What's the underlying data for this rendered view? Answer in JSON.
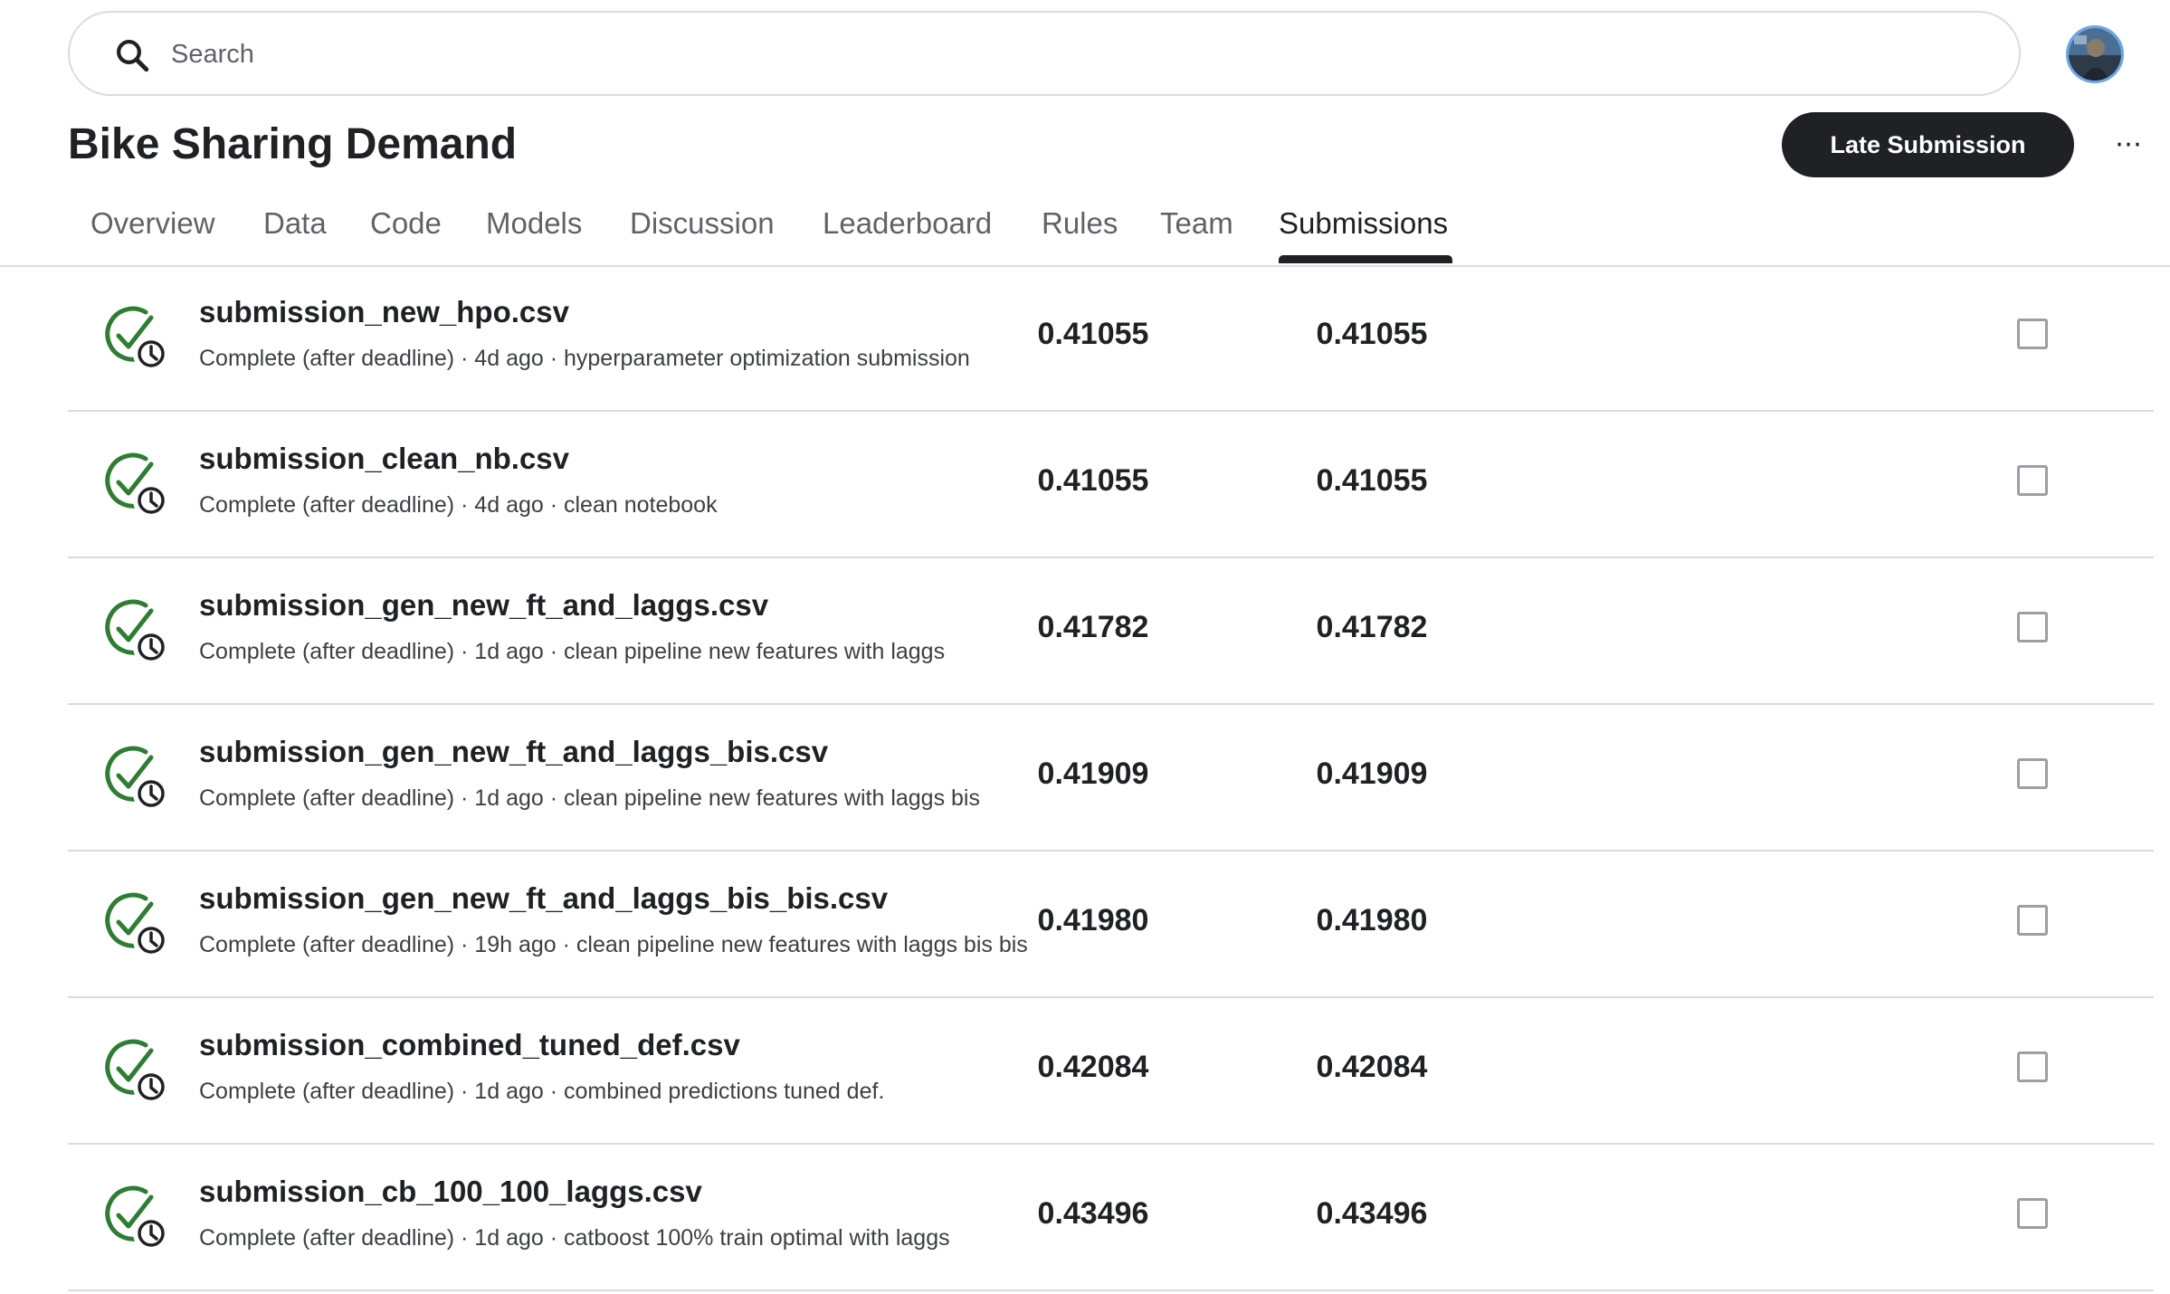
{
  "search": {
    "placeholder": "Search"
  },
  "header": {
    "title": "Bike Sharing Demand",
    "late_submission_label": "Late Submission",
    "more_label": "⋯"
  },
  "tabs": [
    {
      "label": "Overview"
    },
    {
      "label": "Data"
    },
    {
      "label": "Code"
    },
    {
      "label": "Models"
    },
    {
      "label": "Discussion"
    },
    {
      "label": "Leaderboard"
    },
    {
      "label": "Rules"
    },
    {
      "label": "Team"
    },
    {
      "label": "Submissions",
      "active": true
    }
  ],
  "colors": {
    "accent_dark": "#202124",
    "success_green": "#2e7d32",
    "divider": "#dadce0"
  },
  "submissions": [
    {
      "name": "submission_new_hpo.csv",
      "meta": "Complete (after deadline) · 4d ago · hyperparameter optimization submission",
      "private_score": "0.41055",
      "public_score": "0.41055",
      "status_icon": "check-circle-clock-icon"
    },
    {
      "name": "submission_clean_nb.csv",
      "meta": "Complete (after deadline) · 4d ago · clean notebook",
      "private_score": "0.41055",
      "public_score": "0.41055",
      "status_icon": "check-circle-clock-icon"
    },
    {
      "name": "submission_gen_new_ft_and_laggs.csv",
      "meta": "Complete (after deadline) · 1d ago · clean pipeline new features with laggs",
      "private_score": "0.41782",
      "public_score": "0.41782",
      "status_icon": "check-circle-clock-icon"
    },
    {
      "name": "submission_gen_new_ft_and_laggs_bis.csv",
      "meta": "Complete (after deadline) · 1d ago · clean pipeline new features with laggs bis",
      "private_score": "0.41909",
      "public_score": "0.41909",
      "status_icon": "check-circle-clock-icon"
    },
    {
      "name": "submission_gen_new_ft_and_laggs_bis_bis.csv",
      "meta": "Complete (after deadline) · 19h ago · clean pipeline new features with laggs bis bis",
      "private_score": "0.41980",
      "public_score": "0.41980",
      "status_icon": "check-circle-clock-icon"
    },
    {
      "name": "submission_combined_tuned_def.csv",
      "meta": "Complete (after deadline) · 1d ago · combined predictions tuned def.",
      "private_score": "0.42084",
      "public_score": "0.42084",
      "status_icon": "check-circle-clock-icon"
    },
    {
      "name": "submission_cb_100_100_laggs.csv",
      "meta": "Complete (after deadline) · 1d ago · catboost 100% train optimal with laggs",
      "private_score": "0.43496",
      "public_score": "0.43496",
      "status_icon": "check-circle-clock-icon"
    }
  ]
}
